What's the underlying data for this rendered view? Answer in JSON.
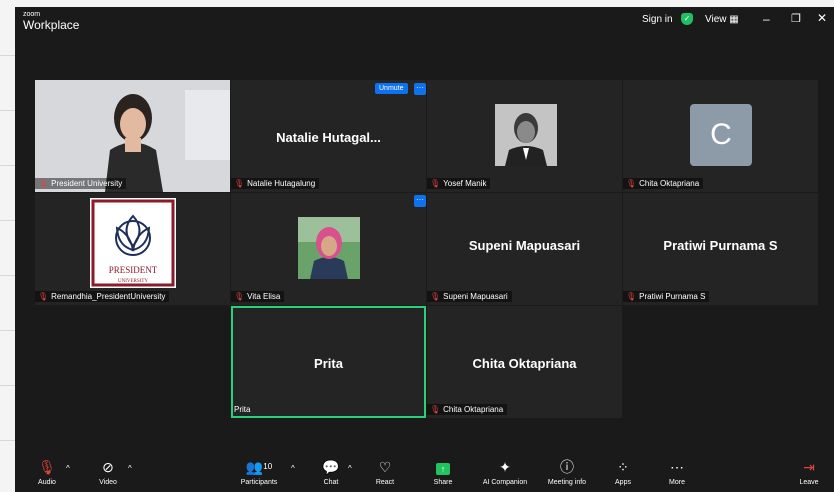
{
  "app": {
    "brand_small": "zoom",
    "brand_name": "Workplace"
  },
  "titlebar": {
    "sign_in": "Sign in",
    "view": "View"
  },
  "controls": {
    "unmute_label": "Unmute",
    "more_dots": "···"
  },
  "participants": [
    {
      "name": "President University",
      "type": "video"
    },
    {
      "name": "Natalie Hutagalung",
      "display": "Natalie  Hutagal..."
    },
    {
      "name": "Yosef Manik",
      "type": "photo"
    },
    {
      "name": "Chita Oktapriana",
      "avatar_letter": "C"
    },
    {
      "name": "Remandhia_PresidentUniversity",
      "type": "logo",
      "logo_text": "PRESIDENT",
      "logo_sub": "UNIVERSITY"
    },
    {
      "name": "Vita Elisa",
      "type": "photo"
    },
    {
      "name": "Supeni Mapuasari",
      "display": "Supeni Mapuasari"
    },
    {
      "name": "Pratiwi Purnama S",
      "display": "Pratiwi Purnama S"
    },
    {
      "name": "Prita",
      "display": "Prita",
      "active": true
    },
    {
      "name": "Chita Oktapriana",
      "display": "Chita Oktapriana"
    }
  ],
  "toolbar": {
    "audio": "Audio",
    "video": "Video",
    "participants": "Participants",
    "participants_count": "10",
    "chat": "Chat",
    "react": "React",
    "share": "Share",
    "ai_companion": "AI Companion",
    "meeting_info": "Meeting info",
    "apps": "Apps",
    "more": "More",
    "leave": "Leave"
  },
  "colors": {
    "background": "#1a1a1a",
    "tile": "#242424",
    "accent_blue": "#0e72ed",
    "active_green": "#2bd07a",
    "share_green": "#22c35e",
    "muted_red": "#e0443c"
  }
}
